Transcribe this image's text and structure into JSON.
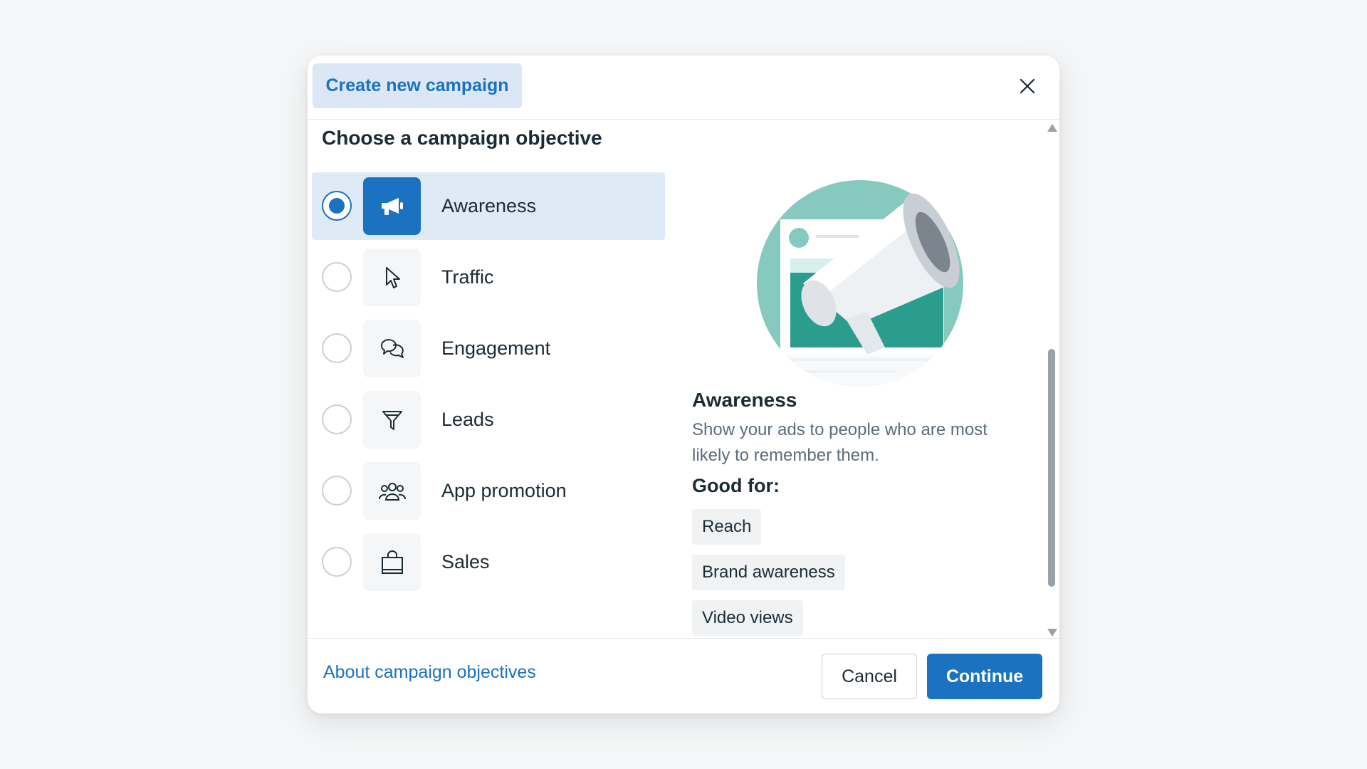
{
  "header": {
    "tab_label": "Create new campaign"
  },
  "section_title": "Choose a campaign objective",
  "objectives": [
    {
      "label": "Awareness",
      "icon": "megaphone-icon",
      "selected": true
    },
    {
      "label": "Traffic",
      "icon": "cursor-icon",
      "selected": false
    },
    {
      "label": "Engagement",
      "icon": "chat-bubbles-icon",
      "selected": false
    },
    {
      "label": "Leads",
      "icon": "filter-icon",
      "selected": false
    },
    {
      "label": "App promotion",
      "icon": "people-icon",
      "selected": false
    },
    {
      "label": "Sales",
      "icon": "shopping-bag-icon",
      "selected": false
    }
  ],
  "detail": {
    "title": "Awareness",
    "description": "Show your ads to people who are most likely to remember them.",
    "good_for_label": "Good for:",
    "good_for": [
      "Reach",
      "Brand awareness",
      "Video views"
    ]
  },
  "footer": {
    "link": "About campaign objectives",
    "cancel": "Cancel",
    "continue": "Continue"
  },
  "colors": {
    "accent": "#1a72c0",
    "selected_bg": "#dfeaf7",
    "tab_bg": "#dbe7f5",
    "illustration_teal": "#2a9d8f"
  }
}
